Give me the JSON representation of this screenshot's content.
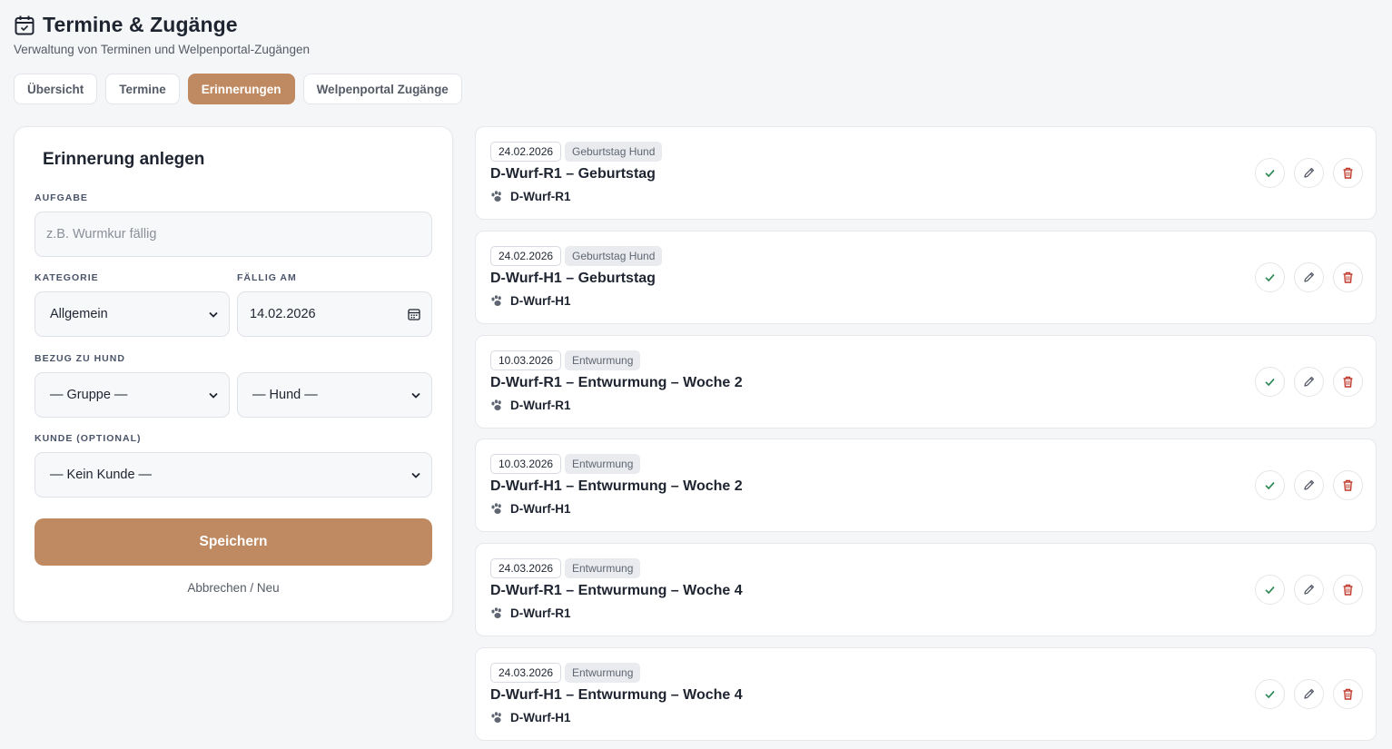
{
  "header": {
    "title": "Termine & Zugänge",
    "subtitle": "Verwaltung von Terminen und Welpenportal-Zugängen"
  },
  "tabs": [
    {
      "label": "Übersicht",
      "active": false
    },
    {
      "label": "Termine",
      "active": false
    },
    {
      "label": "Erinnerungen",
      "active": true
    },
    {
      "label": "Welpenportal Zugänge",
      "active": false
    }
  ],
  "form": {
    "title": "Erinnerung anlegen",
    "task_label": "Aufgabe",
    "task_placeholder": "z.B. Wurmkur fällig",
    "category_label": "Kategorie",
    "category_value": "Allgemein",
    "due_label": "Fällig am",
    "due_value": "14.02.2026",
    "dog_label": "Bezug zu Hund",
    "group_value": "— Gruppe —",
    "dog_value": "— Hund —",
    "customer_label": "Kunde (optional)",
    "customer_value": "— Kein Kunde —",
    "save_label": "Speichern",
    "cancel_label": "Abbrechen / Neu"
  },
  "reminders": [
    {
      "date": "24.02.2026",
      "category": "Geburtstag Hund",
      "title": "D-Wurf-R1 – Geburtstag",
      "dog": "D-Wurf-R1"
    },
    {
      "date": "24.02.2026",
      "category": "Geburtstag Hund",
      "title": "D-Wurf-H1 – Geburtstag",
      "dog": "D-Wurf-H1"
    },
    {
      "date": "10.03.2026",
      "category": "Entwurmung",
      "title": "D-Wurf-R1 – Entwurmung – Woche 2",
      "dog": "D-Wurf-R1"
    },
    {
      "date": "10.03.2026",
      "category": "Entwurmung",
      "title": "D-Wurf-H1 – Entwurmung – Woche 2",
      "dog": "D-Wurf-H1"
    },
    {
      "date": "24.03.2026",
      "category": "Entwurmung",
      "title": "D-Wurf-R1 – Entwurmung – Woche 4",
      "dog": "D-Wurf-R1"
    },
    {
      "date": "24.03.2026",
      "category": "Entwurmung",
      "title": "D-Wurf-H1 – Entwurmung – Woche 4",
      "dog": "D-Wurf-H1"
    }
  ],
  "colors": {
    "accent": "#bf8a62",
    "done": "#2e8a57",
    "delete": "#c0392b"
  },
  "icons": [
    "calendar-check-icon",
    "chevron-down-icon",
    "calendar-icon",
    "paw-icon",
    "check-icon",
    "pencil-icon",
    "trash-icon"
  ]
}
